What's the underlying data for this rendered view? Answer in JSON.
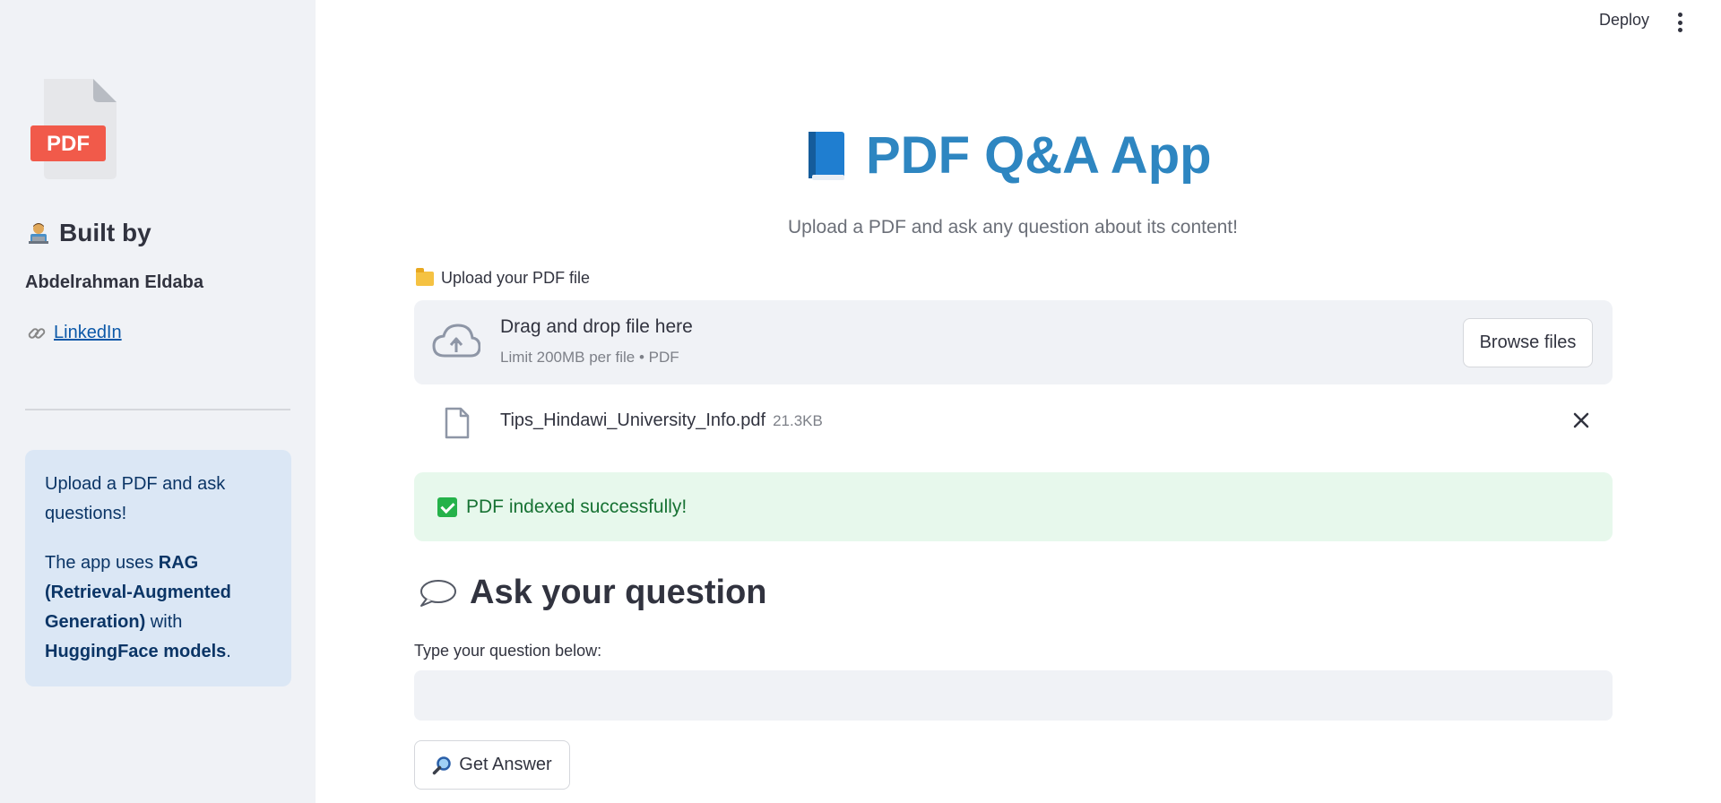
{
  "sidebar": {
    "logo_text": "PDF",
    "built_by": "Built by",
    "author": "Abdelrahman Eldaba",
    "link_label": "LinkedIn",
    "info": {
      "p1": "Upload a PDF and ask questions!",
      "p2_pre": "The app uses ",
      "p2_bold1": "RAG (Retrieval-Augmented Generation)",
      "p2_mid": " with ",
      "p2_bold2": "HuggingFace models",
      "p2_end": "."
    }
  },
  "header": {
    "deploy_label": "Deploy",
    "menu_icon": "more-vertical-icon"
  },
  "main": {
    "title": "PDF Q&A App",
    "subtitle": "Upload a PDF and ask any question about its content!",
    "upload_label": "Upload your PDF file",
    "dropzone": {
      "title": "Drag and drop file here",
      "limit": "Limit 200MB per file • PDF",
      "browse_label": "Browse files"
    },
    "file": {
      "name": "Tips_Hindawi_University_Info.pdf",
      "size": "21.3KB"
    },
    "success": "PDF indexed successfully!",
    "ask_heading": "Ask your question",
    "question_label": "Type your question below:",
    "question_value": "",
    "button_label": "Get Answer"
  },
  "colors": {
    "accent": "#2e86c1",
    "sidebar_bg": "#f0f2f6",
    "info_bg": "#dbe7f5",
    "success_bg": "#e7f8ec",
    "success_text": "#177233",
    "pdf_red": "#f15a4a"
  }
}
